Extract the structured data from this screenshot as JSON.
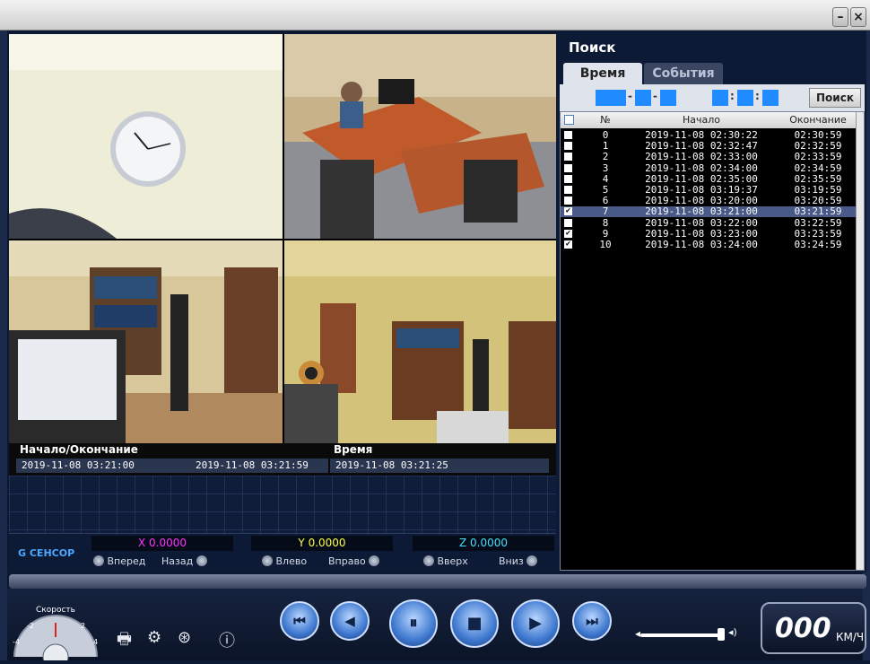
{
  "window": {
    "minimize_icon": "minimize-icon",
    "close_icon": "close-icon",
    "minimize_glyph": "–",
    "close_glyph": "×"
  },
  "info": {
    "start_end_label": "Начало/Окончание",
    "start_value": "2019-11-08 03:21:00",
    "end_value": "2019-11-08 03:21:59",
    "time_label": "Время",
    "time_value": "2019-11-08 03:21:25"
  },
  "gsensor": {
    "title": "G СЕНСОР",
    "x": {
      "value": "X 0.0000",
      "color": "#ff33ff",
      "left": "Вперед",
      "right": "Назад"
    },
    "y": {
      "value": "Y 0.0000",
      "color": "#ffff44",
      "left": "Влево",
      "right": "Вправо"
    },
    "z": {
      "value": "Z 0.0000",
      "color": "#44e0ff",
      "left": "Вверх",
      "right": "Вниз"
    }
  },
  "search": {
    "title": "Поиск",
    "tab_time": "Время",
    "tab_events": "События",
    "button": "Поиск"
  },
  "list": {
    "headers": {
      "num": "№",
      "start": "Начало",
      "end": "Окончание"
    },
    "rows": [
      {
        "n": "0",
        "start": "2019-11-08 02:30:22",
        "end": "02:30:59",
        "checked": false,
        "selected": false
      },
      {
        "n": "1",
        "start": "2019-11-08 02:32:47",
        "end": "02:32:59",
        "checked": false,
        "selected": false
      },
      {
        "n": "2",
        "start": "2019-11-08 02:33:00",
        "end": "02:33:59",
        "checked": false,
        "selected": false
      },
      {
        "n": "3",
        "start": "2019-11-08 02:34:00",
        "end": "02:34:59",
        "checked": false,
        "selected": false
      },
      {
        "n": "4",
        "start": "2019-11-08 02:35:00",
        "end": "02:35:59",
        "checked": false,
        "selected": false
      },
      {
        "n": "5",
        "start": "2019-11-08 03:19:37",
        "end": "03:19:59",
        "checked": false,
        "selected": false
      },
      {
        "n": "6",
        "start": "2019-11-08 03:20:00",
        "end": "03:20:59",
        "checked": false,
        "selected": false
      },
      {
        "n": "7",
        "start": "2019-11-08 03:21:00",
        "end": "03:21:59",
        "checked": true,
        "selected": true
      },
      {
        "n": "8",
        "start": "2019-11-08 03:22:00",
        "end": "03:22:59",
        "checked": false,
        "selected": false
      },
      {
        "n": "9",
        "start": "2019-11-08 03:23:00",
        "end": "03:23:59",
        "checked": true,
        "selected": false
      },
      {
        "n": "10",
        "start": "2019-11-08 03:24:00",
        "end": "03:24:59",
        "checked": true,
        "selected": false
      }
    ]
  },
  "speed_gauge": {
    "label": "Скорость",
    "ticks": [
      "-4",
      "-2",
      "2",
      "4"
    ]
  },
  "speed_display": {
    "value": "000",
    "unit": "КМ/Ч"
  },
  "colors": {
    "accent": "#1f8bff",
    "panel": "#0d1a36",
    "selected_row": "#4a5a88"
  },
  "playback": {
    "prev": "⏮",
    "rewind": "◀",
    "pause": "⏸",
    "stop": "■",
    "play": "▶",
    "next": "⏭"
  }
}
